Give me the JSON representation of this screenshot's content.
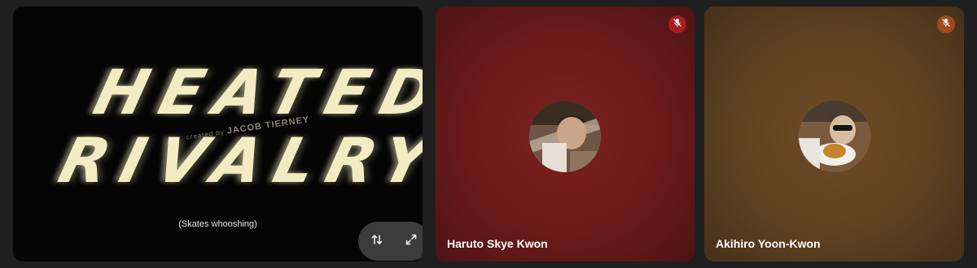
{
  "screen_share": {
    "title_line1": "HEATED",
    "title_line2": "RIVALRY",
    "credit_prefix": "created by",
    "credit_name": "JACOB TIERNEY",
    "caption": "(Skates whooshing)",
    "controls": {
      "swap_icon": "swap-vertical-icon",
      "fullscreen_icon": "fullscreen-icon"
    }
  },
  "participants": [
    {
      "name": "Haruto Skye Kwon",
      "muted": true,
      "tile_color": "#6a1a1a",
      "badge_color": "#a51e1e"
    },
    {
      "name": "Akihiro Yoon-Kwon",
      "muted": true,
      "tile_color": "#5e4120",
      "badge_color": "#a0481e"
    }
  ]
}
